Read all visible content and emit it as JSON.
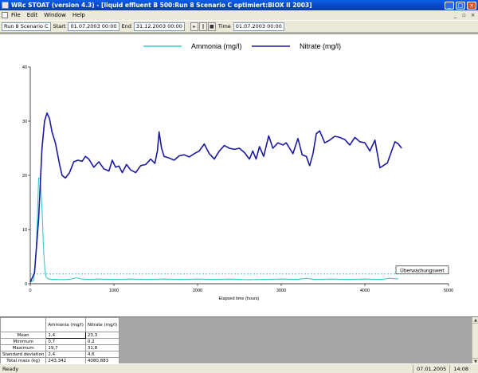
{
  "window": {
    "title": "WRc STOAT (version 4.3) - [liquid effluent B 500:Run 8 Scenario C optimiert:BIOX II 2003]",
    "minimize": "_",
    "maximize": "□",
    "close": "×"
  },
  "menu": {
    "items": [
      "File",
      "Edit",
      "Window",
      "Help"
    ],
    "doc_minimize": "_",
    "doc_restore": "▫",
    "doc_close": "×"
  },
  "toolbar": {
    "run_name": "Run 8 Scenario C",
    "start_label": "Start",
    "start_value": "01.07.2003 00:00",
    "end_label": "End",
    "end_value": "31.12.2003 00:00",
    "buttons": [
      "▸",
      "‖",
      "■"
    ],
    "time_label": "Time",
    "time_value": "01.07.2003 00:00"
  },
  "chart_data": {
    "type": "line",
    "xlabel": "Elapsed time (hours)",
    "ylabel": "",
    "xlim": [
      0,
      5000
    ],
    "ylim": [
      0,
      40
    ],
    "x_ticks": [
      "0",
      "1000",
      "2000",
      "3000",
      "4000",
      "5000"
    ],
    "y_ticks": [
      "0",
      "10",
      "20",
      "30",
      "40"
    ],
    "legend_position": "top",
    "grid": false,
    "annotation": {
      "text": "Überwachungswert",
      "y": 1.8,
      "color": "#3cc8c8"
    },
    "series": [
      {
        "name": "Ammonia (mg/l)",
        "color": "#3cc8c8",
        "x": [
          0,
          40,
          70,
          90,
          100,
          120,
          140,
          160,
          175,
          190,
          210,
          250,
          300,
          400,
          500,
          550,
          600,
          700,
          800,
          1000,
          1200,
          1400,
          1600,
          1800,
          2000,
          2200,
          2400,
          2600,
          2800,
          3000,
          3200,
          3300,
          3400,
          3600,
          3800,
          4000,
          4200,
          4300,
          4400
        ],
        "values": [
          0.3,
          0.6,
          6,
          15,
          19.5,
          19.5,
          14,
          6,
          2.5,
          1.2,
          0.9,
          0.8,
          0.8,
          0.75,
          0.9,
          1.1,
          0.9,
          0.8,
          0.85,
          0.8,
          0.85,
          0.8,
          0.85,
          0.8,
          0.85,
          0.8,
          0.85,
          0.75,
          0.8,
          0.85,
          0.8,
          1.0,
          0.8,
          0.85,
          0.8,
          0.85,
          0.8,
          1.0,
          0.9
        ]
      },
      {
        "name": "Nitrate (mg/l)",
        "color": "#1a1aa0",
        "x": [
          0,
          50,
          100,
          140,
          170,
          200,
          230,
          260,
          300,
          350,
          380,
          420,
          470,
          520,
          570,
          620,
          660,
          700,
          760,
          820,
          880,
          940,
          980,
          1020,
          1060,
          1100,
          1150,
          1200,
          1260,
          1320,
          1380,
          1440,
          1490,
          1520,
          1540,
          1570,
          1600,
          1660,
          1720,
          1780,
          1840,
          1900,
          1960,
          2020,
          2080,
          2140,
          2200,
          2260,
          2320,
          2380,
          2440,
          2500,
          2560,
          2620,
          2660,
          2700,
          2740,
          2790,
          2850,
          2900,
          2960,
          3020,
          3060,
          3100,
          3140,
          3200,
          3250,
          3300,
          3340,
          3380,
          3420,
          3460,
          3520,
          3580,
          3640,
          3700,
          3760,
          3820,
          3880,
          3940,
          4000,
          4060,
          4120,
          4180,
          4220,
          4270,
          4320,
          4360,
          4400,
          4440
        ],
        "values": [
          0.3,
          2,
          12,
          25,
          30,
          31.5,
          30.5,
          28,
          26,
          22,
          20,
          19.5,
          20.5,
          22.5,
          22.8,
          22.6,
          23.5,
          23,
          21.5,
          22.5,
          21.2,
          20.8,
          22.8,
          21.5,
          21.7,
          20.5,
          22,
          21,
          20.5,
          21.8,
          22,
          23,
          22.2,
          24.5,
          28,
          25,
          23.5,
          23.2,
          22.8,
          23.6,
          23.8,
          23.4,
          24,
          24.5,
          25.8,
          24,
          23,
          24.5,
          25.5,
          25,
          24.8,
          25,
          24.2,
          23,
          24.5,
          23,
          25.3,
          23.5,
          27.3,
          25,
          26,
          25.6,
          26,
          25,
          24,
          26.8,
          23.8,
          23.5,
          21.8,
          24,
          27.7,
          28.2,
          26,
          26.5,
          27.2,
          27,
          26.6,
          25.6,
          27,
          26.2,
          26,
          24.5,
          26.5,
          21.4,
          21.8,
          22.3,
          24.5,
          26.2,
          25.8,
          25
        ]
      }
    ]
  },
  "stats": {
    "headers": [
      "",
      "Ammonia (mg/l)",
      "Nitrate (mg/l)"
    ],
    "rows": [
      {
        "label": "Mean",
        "a": "1,4",
        "n": "23,3"
      },
      {
        "label": "Minimum",
        "a": "0,7",
        "n": "0,2"
      },
      {
        "label": "Maximum",
        "a": "19,7",
        "n": "31,8"
      },
      {
        "label": "Standard deviation",
        "a": "2,4",
        "n": "4,6"
      },
      {
        "label": "Total mass (kg)",
        "a": "243,342",
        "n": "4080,883"
      }
    ]
  },
  "status": {
    "ready": "Ready",
    "date": "07.01.2005",
    "time": "14:08"
  }
}
